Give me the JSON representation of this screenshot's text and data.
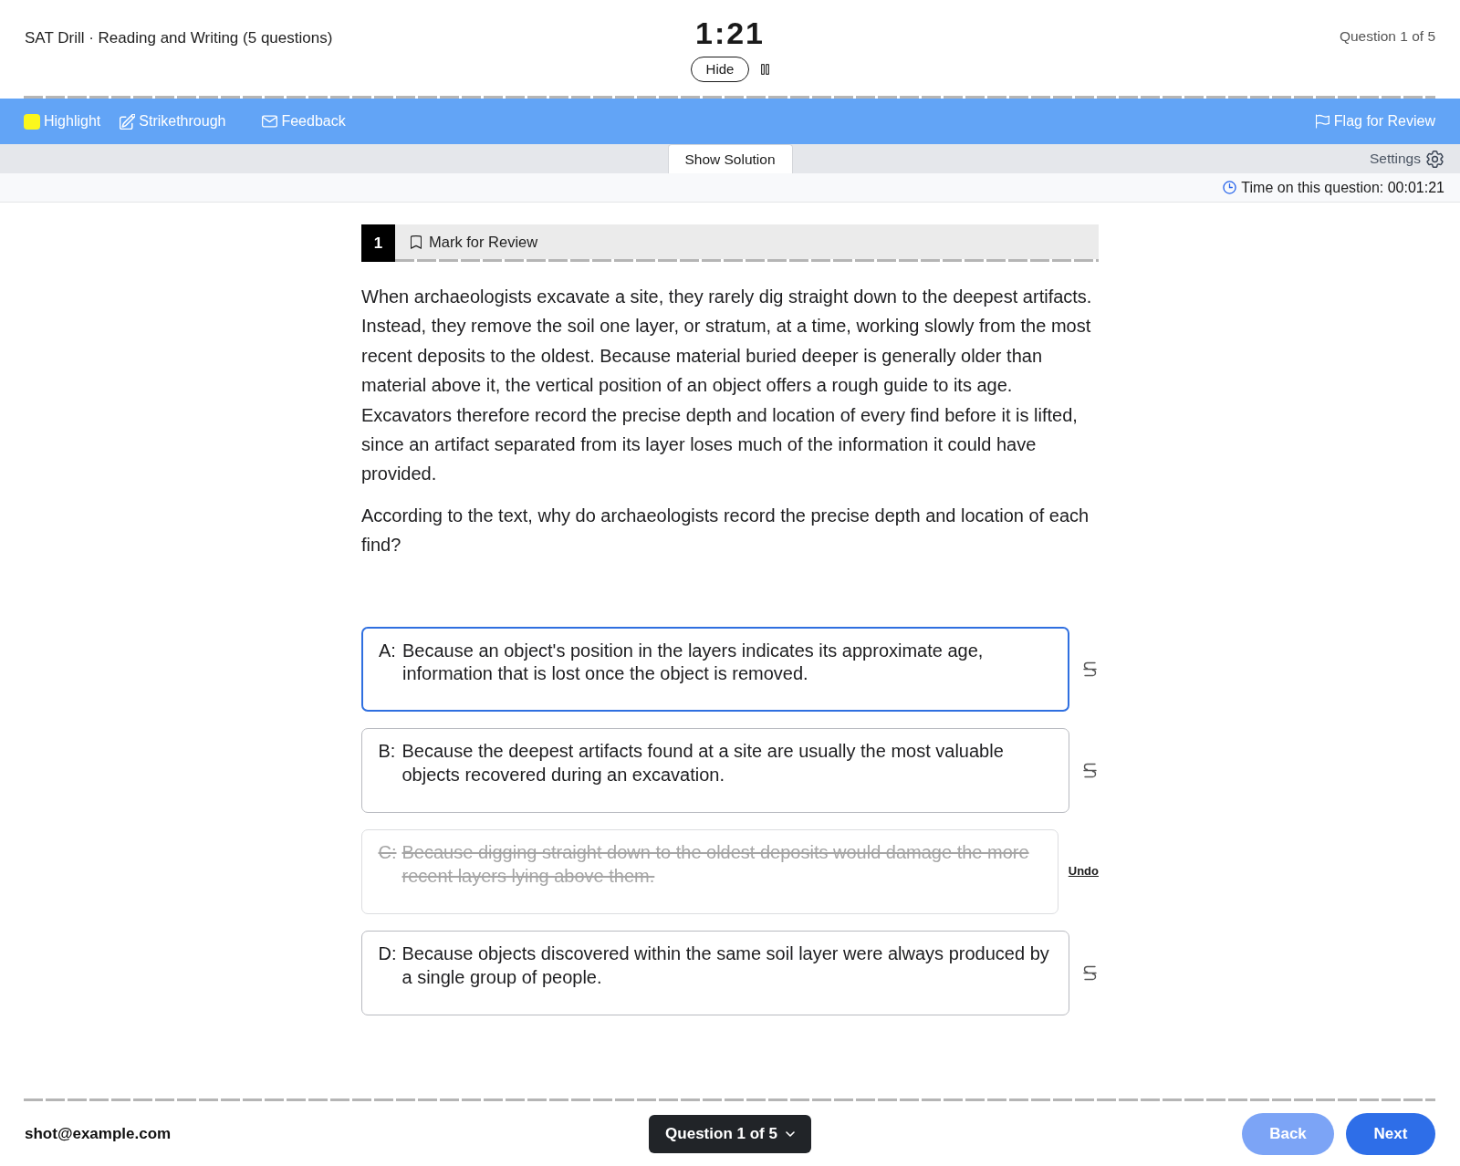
{
  "header": {
    "title": "SAT Drill · Reading and Writing (5 questions)",
    "timer": "1:21",
    "hide_button": "Hide",
    "progress": "Question 1 of 5"
  },
  "toolbar": {
    "tools": [
      {
        "kind": "highlight",
        "label": "Highlight"
      },
      {
        "kind": "strikethrough",
        "label": "Strikethrough"
      },
      {
        "kind": "feedback",
        "label": "Feedback"
      }
    ],
    "flag": "Flag for Review"
  },
  "subbar": {
    "show_solution": "Show Solution",
    "settings": "Settings"
  },
  "time_bar": {
    "text": "Time on this question: **00:01:21**"
  },
  "question": {
    "number": "1",
    "mark_for_review": "Mark for Review",
    "marked": false,
    "passage": "When archaeologists excavate a site, they rarely dig straight down to the deepest artifacts. Instead, they remove the soil one layer, or stratum, at a time, working slowly from the most recent deposits to the oldest. Because material buried deeper is generally older than material above it, the vertical position of an object offers a rough guide to its age. Excavators therefore record the precise depth and location of every find before it is lifted, since an artifact separated from its layer loses much of the information it could have provided.",
    "prompt": "According to the text, why do archaeologists record the precise depth and location of each find?",
    "choices": [
      {
        "letter": "A:",
        "text": "Because an object's position in the layers indicates its approximate age, information that is lost once the object is removed.",
        "selected": true,
        "crossed_out": false
      },
      {
        "letter": "B:",
        "text": "Because the deepest artifacts found at a site are usually the most valuable objects recovered during an excavation.",
        "selected": false,
        "crossed_out": false
      },
      {
        "letter": "C:",
        "text": "Because digging straight down to the oldest deposits would damage the more recent layers lying above them.",
        "selected": false,
        "crossed_out": true,
        "undo": "Undo"
      },
      {
        "letter": "D:",
        "text": "Because objects discovered within the same soil layer were always produced by a single group of people.",
        "selected": false,
        "crossed_out": false
      }
    ]
  },
  "footer": {
    "email": "shot@example.com",
    "navigator": "Question 1 of 5",
    "back": {
      "label": "Back",
      "disabled": true
    },
    "next": {
      "label": "Next",
      "disabled": false
    }
  }
}
